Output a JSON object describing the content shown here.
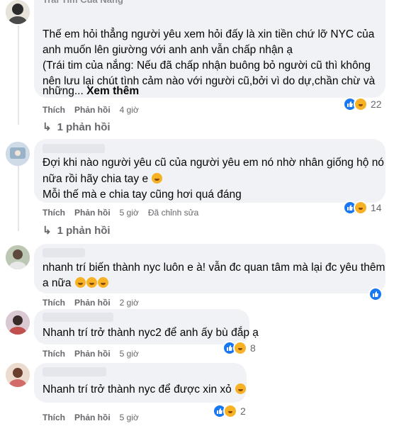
{
  "colors": {
    "like": "#1877f2",
    "haha": "#f7b125",
    "bubble": "#f0f2f5",
    "meta": "#65676b"
  },
  "comments": [
    {
      "author": "Trái Tim Của Nắng",
      "lines": [
        "Thế em hỏi thẳng người yêu xem hỏi đấy là xin tiền chứ lỡ NYC của",
        "anh muốn lên giường với anh anh vẫn chấp nhận ạ",
        "(Trái tim của nắng: Nếu đã chấp nhận buông bỏ người cũ thì không",
        "nên lưu lại chút tình cảm nào với người cũ,bởi vì do dự,chần chừ và"
      ],
      "last_line": "những...",
      "see_more": "Xem thêm",
      "like": "Thích",
      "reply": "Phản hồi",
      "time": "4 giờ",
      "reaction_count": "22",
      "reply_count_label": "1 phản hồi"
    },
    {
      "lines": [
        "Đợi khi nào người yêu cũ của người yêu em nó nhờ nhân giống hộ nó",
        "nữa rồi hãy chia tay e",
        "Mỗi thế mà e chia tay cũng hơi quá đáng"
      ],
      "like": "Thích",
      "reply": "Phản hồi",
      "time": "5 giờ",
      "edited": "Đã chỉnh sửa",
      "reaction_count": "14",
      "reply_count_label": "1 phản hồi"
    },
    {
      "lines": [
        "nhanh trí biến thành nyc luôn e à! vẫn đc quan tâm mà lại đc yêu thêm",
        "a nữa"
      ],
      "like": "Thích",
      "reply": "Phản hồi",
      "time": "2 giờ"
    },
    {
      "lines": [
        "Nhanh trí trở thành nyc2 để anh ấy bù đắp ạ"
      ],
      "like": "Thích",
      "reply": "Phản hồi",
      "time": "5 giờ",
      "reaction_count": "8"
    },
    {
      "lines": [
        "Nhanh trí trở thành nyc để được xin xỏ"
      ],
      "like": "Thích",
      "reply": "Phản hồi",
      "time": "5 giờ",
      "reaction_count": "2"
    }
  ]
}
